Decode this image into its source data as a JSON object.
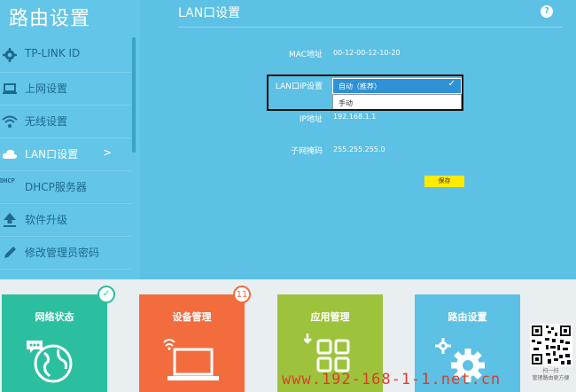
{
  "app": {
    "title": "路由设置"
  },
  "sidebar": {
    "items": [
      {
        "label": "TP-LINK ID"
      },
      {
        "label": "上网设置"
      },
      {
        "label": "无线设置"
      },
      {
        "label": "LAN口设置",
        "arrow": ">"
      },
      {
        "label": "DHCP服务器",
        "icon_text": "DHCP"
      },
      {
        "label": "软件升级"
      },
      {
        "label": "修改管理员密码"
      }
    ]
  },
  "main": {
    "title": "LAN口设置",
    "help": "?",
    "fields": {
      "mac": {
        "label": "MAC地址",
        "value": "00-12-00-12-10-20"
      },
      "ip_mode": {
        "label": "LAN口IP设置",
        "selected": "自动（推荐）",
        "options": [
          "手动"
        ]
      },
      "ip": {
        "label": "IP地址",
        "value": "192.168.1.1"
      },
      "subnet": {
        "label": "子网掩码",
        "value": "255.255.255.0"
      }
    },
    "save_label": "保存"
  },
  "tiles": [
    {
      "label": "网络状态",
      "color": "#2bbfa0"
    },
    {
      "label": "设备管理",
      "color": "#f26c3e",
      "badge": "11"
    },
    {
      "label": "应用管理",
      "color": "#9cc33b"
    },
    {
      "label": "路由设置",
      "color": "#5cc1e4"
    }
  ],
  "qr": {
    "caption_line1": "扫一扫",
    "caption_line2": "管理路由更方便"
  },
  "watermark": "www.192-168-1-1.net.cn"
}
